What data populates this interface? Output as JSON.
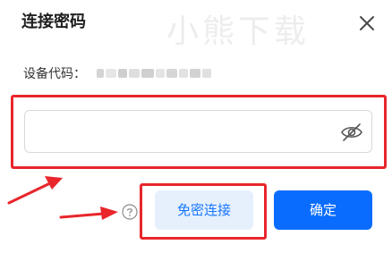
{
  "dialog": {
    "title": "连接密码",
    "watermark": "小熊下载",
    "close_icon": "close-icon"
  },
  "device": {
    "label": "设备代码：",
    "code_blurred": true
  },
  "password": {
    "value": "",
    "placeholder": "",
    "toggle_icon": "eye-off-icon"
  },
  "actions": {
    "help_icon": "help-circle-icon",
    "no_password_label": "免密连接",
    "confirm_label": "确定"
  },
  "colors": {
    "primary": "#0a6cff",
    "primary_light": "#e6f0fd",
    "annotation_red": "#e8262b"
  }
}
